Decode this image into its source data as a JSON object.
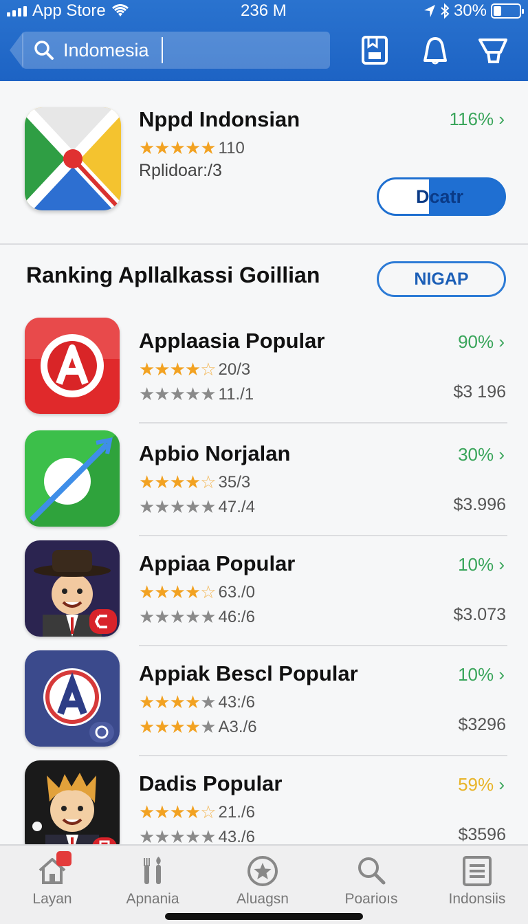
{
  "status": {
    "carrier": "App Store",
    "time": "236 M",
    "battery": "30%",
    "battery_level": 0.3
  },
  "search": {
    "value": "Indomesia"
  },
  "featured": {
    "title": "Nppd Indonsian",
    "rating_text": "110",
    "stars": 5,
    "subtitle": "Rplidoar:/3",
    "percent": "116%",
    "button_label": "Dcatr"
  },
  "section": {
    "title": "Ranking Apllalkassi Goillian",
    "button_label": "NIGAP"
  },
  "apps": [
    {
      "name": "Applaasia Popular",
      "rating1": "20/3",
      "stars1": 4.5,
      "rating2": "11./1",
      "stars2": 5,
      "stars2_color": "gray",
      "percent": "90%",
      "price": "$3 196",
      "percent_color": "#3aa55b"
    },
    {
      "name": "Apbio Norjalan",
      "rating1": "35/3",
      "stars1": 4.5,
      "rating2": "47./4",
      "stars2": 5,
      "stars2_color": "gray",
      "percent": "30%",
      "price": "$3.996",
      "percent_color": "#3aa55b"
    },
    {
      "name": "Appiaa Popular",
      "rating1": "63./0",
      "stars1": 4.5,
      "rating2": "46:/6",
      "stars2": 5,
      "stars2_color": "gray",
      "percent": "10%",
      "price": "$3.073",
      "percent_color": "#3aa55b"
    },
    {
      "name": "Appiak Bescl Popular",
      "rating1": "43:/6",
      "stars1": 4,
      "rating2": "A3./6",
      "stars2": 4,
      "stars2_color": "gold",
      "percent": "10%",
      "price": "$3296",
      "percent_color": "#3aa55b"
    },
    {
      "name": "Dadis Popular",
      "rating1": "21./6",
      "stars1": 4.5,
      "rating2": "43./6",
      "stars2": 5,
      "stars2_color": "gray",
      "percent": "59%",
      "price": "$3596",
      "percent_color": "#e8b429"
    }
  ],
  "tabs": [
    {
      "label": "Layan",
      "icon": "home-icon"
    },
    {
      "label": "Apnania",
      "icon": "tools-icon"
    },
    {
      "label": "Aluagsn",
      "icon": "star-circle-icon"
    },
    {
      "label": "Poarioıs",
      "icon": "search-icon"
    },
    {
      "label": "Indonsiis",
      "icon": "list-icon"
    }
  ],
  "colors": {
    "header": "#1d63c4",
    "accent": "#1e6fd0",
    "green": "#3aa55b"
  }
}
